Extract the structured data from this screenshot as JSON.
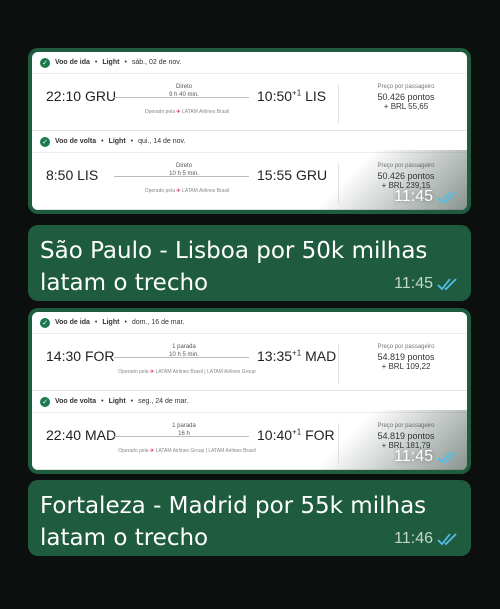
{
  "messages": [
    {
      "type": "image",
      "time": "11:45",
      "legs": [
        {
          "head_title": "Voo de ida",
          "head_cabin": "Light",
          "head_date": "sáb., 02 de nov.",
          "dep_time": "22:10",
          "dep_airport": "GRU",
          "stop_label": "Direto",
          "duration": "9 h 40 min.",
          "arr_time": "10:50",
          "arr_day": "+1",
          "arr_airport": "LIS",
          "operated_label": "Operado pela",
          "operators": "LATAM Airlines Brasil",
          "price_label": "Preço por passageiro",
          "points": "50.426 pontos",
          "brl": "+ BRL 55,65"
        },
        {
          "head_title": "Voo de volta",
          "head_cabin": "Light",
          "head_date": "qui., 14 de nov.",
          "dep_time": "8:50",
          "dep_airport": "LIS",
          "stop_label": "Direto",
          "duration": "10 h 5 min.",
          "arr_time": "15:55",
          "arr_day": "",
          "arr_airport": "GRU",
          "operated_label": "Operado pela",
          "operators": "LATAM Airlines Brasil",
          "price_label": "Preço por passageiro",
          "points": "50.426 pontos",
          "brl": "+ BRL 239,15"
        }
      ]
    },
    {
      "type": "text",
      "text": "São Paulo - Lisboa por 50k milhas latam o trecho",
      "time": "11:45"
    },
    {
      "type": "image",
      "time": "11:45",
      "legs": [
        {
          "head_title": "Voo de ida",
          "head_cabin": "Light",
          "head_date": "dom., 16 de mar.",
          "dep_time": "14:30",
          "dep_airport": "FOR",
          "stop_label": "1 parada",
          "duration": "10 h 5 min.",
          "arr_time": "13:35",
          "arr_day": "+1",
          "arr_airport": "MAD",
          "operated_label": "Operado pela",
          "operators": "LATAM Airlines Brasil | LATAM Airlines Group",
          "price_label": "Preço por passageiro",
          "points": "54.819 pontos",
          "brl": "+ BRL 109,22"
        },
        {
          "head_title": "Voo de volta",
          "head_cabin": "Light",
          "head_date": "seg., 24 de mar.",
          "dep_time": "22:40",
          "dep_airport": "MAD",
          "stop_label": "1 parada",
          "duration": "16 h",
          "arr_time": "10:40",
          "arr_day": "+1",
          "arr_airport": "FOR",
          "operated_label": "Operado pela",
          "operators": "LATAM Airlines Group | LATAM Airlines Brasil",
          "price_label": "Preço por passageiro",
          "points": "54.819 pontos",
          "brl": "+ BRL 181,79"
        }
      ]
    },
    {
      "type": "text",
      "text": "Fortaleza - Madrid por 55k milhas latam o trecho",
      "time": "11:46"
    }
  ],
  "colors": {
    "bubble": "#1f5c3f",
    "background": "#0b0f0d",
    "read_ticks": "#53bdeb",
    "latam_accent": "#e23e57"
  },
  "icons": [
    "check-icon",
    "plane-icon",
    "double-check-icon"
  ]
}
